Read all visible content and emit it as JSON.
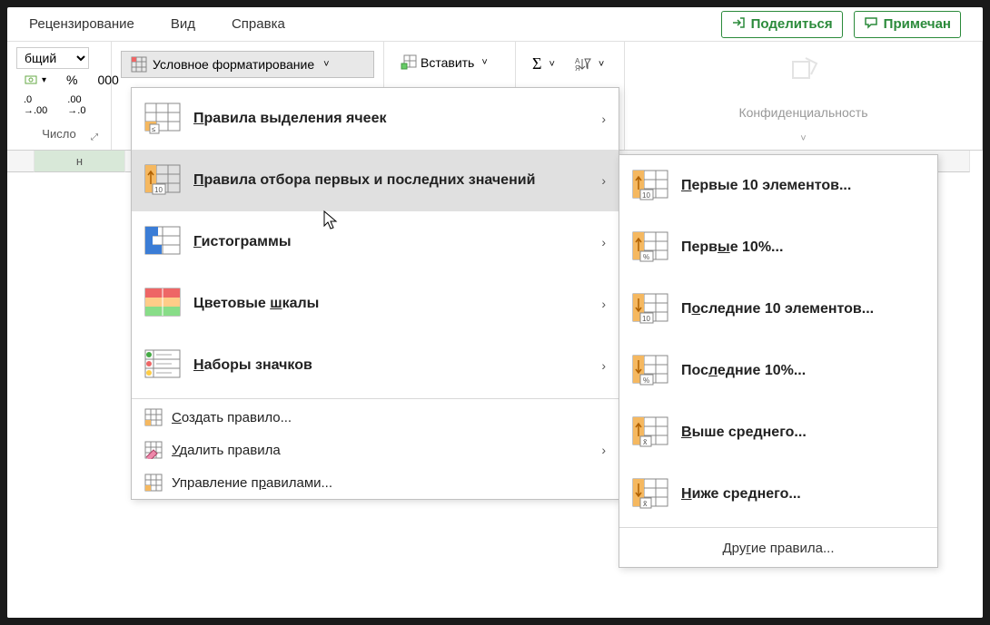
{
  "tabs": {
    "review": "Рецензирование",
    "view": "Вид",
    "help": "Справка"
  },
  "header": {
    "share": "Поделиться",
    "comments": "Примечан"
  },
  "number": {
    "format": "бщий",
    "label": "Число",
    "percent": "%",
    "thousands": "000",
    "inc": ".0",
    "dec": ".00"
  },
  "cf": {
    "button": "Условное форматирование"
  },
  "insert": {
    "button": "Вставить"
  },
  "sens": {
    "label": "Конфиденциальность"
  },
  "menu1": {
    "highlight": "Правила выделения ячеек",
    "toprank": "Правила отбора первых и последних значений",
    "dbars": "Гистограммы",
    "cscales": "Цветовые шкалы",
    "iconsets": "Наборы значков",
    "newrule": "Создать правило...",
    "clear": "Удалить правила",
    "manage": "Управление правилами..."
  },
  "menu2": {
    "top10": "Первые 10 элементов...",
    "top10p": "Первые 10%...",
    "bot10": "Последние 10 элементов...",
    "bot10p": "Последние 10%...",
    "above": "Выше среднего...",
    "below": "Ниже среднего...",
    "more": "Другие правила..."
  },
  "cols": {
    "h": "н"
  }
}
